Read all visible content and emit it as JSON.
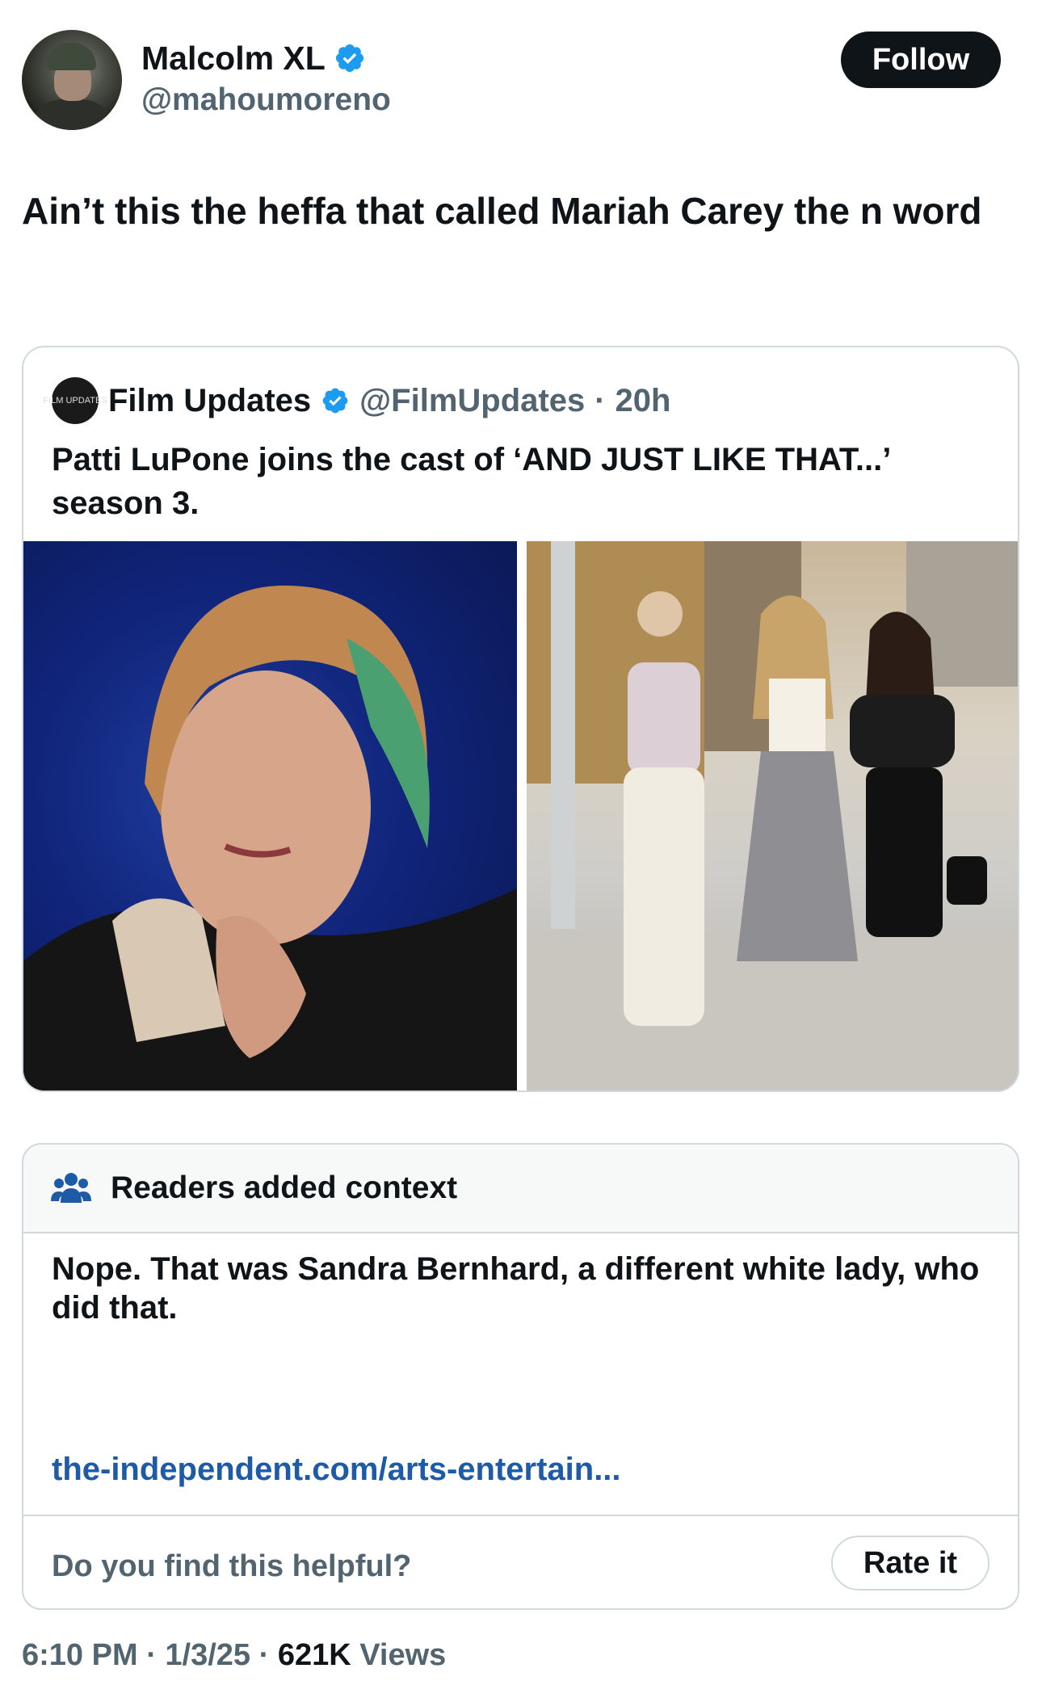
{
  "author": {
    "name": "Malcolm XL",
    "handle": "@mahoumoreno",
    "verified": true
  },
  "follow_label": "Follow",
  "tweet_text": "Ain’t this the heffa that called Mariah Carey the n word",
  "quoted": {
    "avatar_text": "FILM UPDATES",
    "name": "Film Updates",
    "handle": "@FilmUpdates",
    "separator": "·",
    "time": "20h",
    "text": "Patti LuPone joins the cast of ‘AND JUST LIKE THAT...’ season 3."
  },
  "context": {
    "title": "Readers added context",
    "body": "Nope. That was Sandra Bernhard, a different white lady, who did that.",
    "link": "the-independent.com/arts-entertain...",
    "question": "Do you find this helpful?",
    "rate_label": "Rate it"
  },
  "meta": {
    "time": "6:10 PM",
    "sep1": "·",
    "date": "1/3/25",
    "sep2": "·",
    "views_count": "621K",
    "views_label": "Views"
  },
  "colors": {
    "verified_blue": "#1d9bf0",
    "link_blue": "#1d5aa7",
    "secondary_text": "#536471",
    "border": "#cfd9de"
  }
}
